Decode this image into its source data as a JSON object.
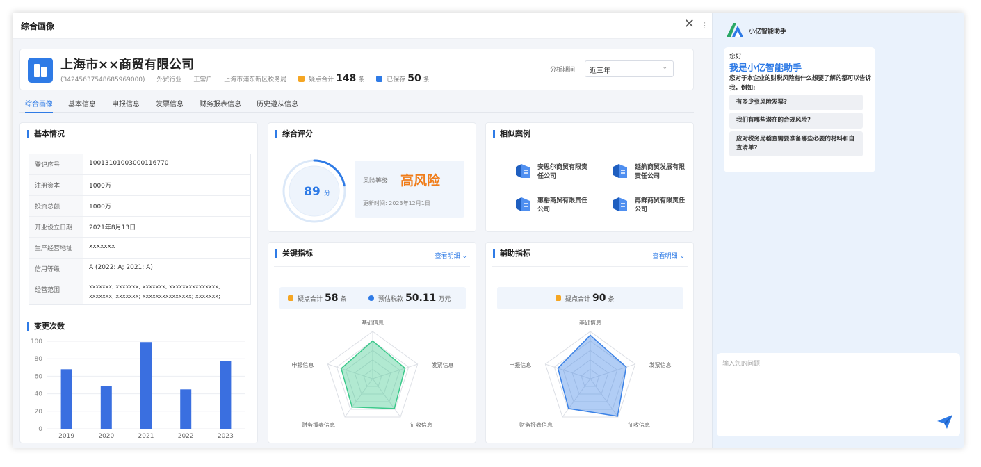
{
  "window": {
    "title": "综合画像",
    "close_glyph": "✕",
    "divider_glyph": "⋮"
  },
  "company": {
    "name": "上海市××商贸有限公司",
    "code": "(342456375486859690​00)",
    "industry": "外贸行业",
    "status": "正常户",
    "tax_office": "上海市浦东新区税务局",
    "doubt_label": "疑点合计",
    "doubt_count": "148",
    "doubt_unit": "条",
    "saved_label": "已保存",
    "saved_count": "50",
    "saved_unit": "条",
    "period_label": "分析期间:",
    "period_value": "近三年",
    "chevron": "⌄",
    "colors": {
      "doubt": "#f5a623",
      "saved": "#2f7be6"
    }
  },
  "tabs": [
    "综合画像",
    "基本信息",
    "申报信息",
    "发票信息",
    "财务报表信息",
    "历史遵从信息"
  ],
  "basic": {
    "title": "基本情况",
    "rows": [
      {
        "k": "登记序号",
        "v": "10013101003000116770"
      },
      {
        "k": "注册资本",
        "v": "1000万"
      },
      {
        "k": "投资总额",
        "v": "1000万"
      },
      {
        "k": "开业设立日期",
        "v": "2021年8月13日"
      },
      {
        "k": "生产经营地址",
        "v": "xxxxxxx"
      },
      {
        "k": "信用等级",
        "v": "A (2022: A; 2021: A)"
      },
      {
        "k": "经营范围",
        "v": "xxxxxxx; xxxxxxx; xxxxxxx; xxxxxxxxxxxxxxx; xxxxxxx; xxxxxxx; xxxxxxxxxxxxxxx; xxxxxxx;"
      }
    ]
  },
  "changes": {
    "title": "变更次数"
  },
  "chart_data": {
    "type": "bar",
    "title": "变更次数",
    "categories": [
      "2019",
      "2020",
      "2021",
      "2022",
      "2023"
    ],
    "values": [
      68,
      49,
      99,
      45,
      77
    ],
    "ylim": [
      0,
      100
    ],
    "yticks": [
      0,
      20,
      40,
      60,
      80,
      100
    ],
    "grid": true,
    "color": "#3a6fe0"
  },
  "score": {
    "title": "综合评分",
    "value": "89",
    "unit": "分",
    "progress": 0.89,
    "risk_label": "风险等级:",
    "risk_value": "高风险",
    "updated": "更新时间: 2023年12月1日",
    "colors": {
      "ring": "#2f7be6",
      "risk": "#f07d1a"
    }
  },
  "cases": {
    "title": "相似案例",
    "items": [
      "安思尔商贸有限责任公司",
      "延航商贸发展有限责任公司",
      "惠裕商贸有限责任公司",
      "再鲜商贸有限责任公司"
    ]
  },
  "key": {
    "title": "关键指标",
    "detail": "查看明细 ⌄",
    "doubt_label": "疑点合计",
    "doubt_count": "58",
    "doubt_unit": "条",
    "est_label": "预估税款",
    "est_value": "50.11",
    "est_unit": "万元",
    "radar_labels": [
      "基础信息",
      "发票信息",
      "征收信息",
      "财务报表信息",
      "申报信息"
    ],
    "radar_values": [
      0.8,
      0.72,
      0.78,
      0.74,
      0.7
    ],
    "color": "#3cc98b"
  },
  "aux": {
    "title": "辅助指标",
    "detail": "查看明细 ⌄",
    "doubt_label": "疑点合计",
    "doubt_count": "90",
    "doubt_unit": "条",
    "radar_labels": [
      "基础信息",
      "发票信息",
      "征收信息",
      "财务报表信息",
      "申报信息"
    ],
    "radar_values": [
      0.92,
      0.8,
      0.98,
      0.78,
      0.72
    ],
    "color": "#3b82e6"
  },
  "assistant": {
    "name": "小亿智能助手",
    "hello": "您好:",
    "iam": "我是小亿智能助手",
    "intro": "您对于本企业的财税风险有什么想要了解的都可以告诉我，例如:",
    "questions": [
      "有多少张风险发票?",
      "我们有哪些潜在的合规风险?",
      "应对税务局稽查需要准备哪些必要的材料和自查清单?"
    ],
    "input_placeholder": "输入您的问题"
  }
}
